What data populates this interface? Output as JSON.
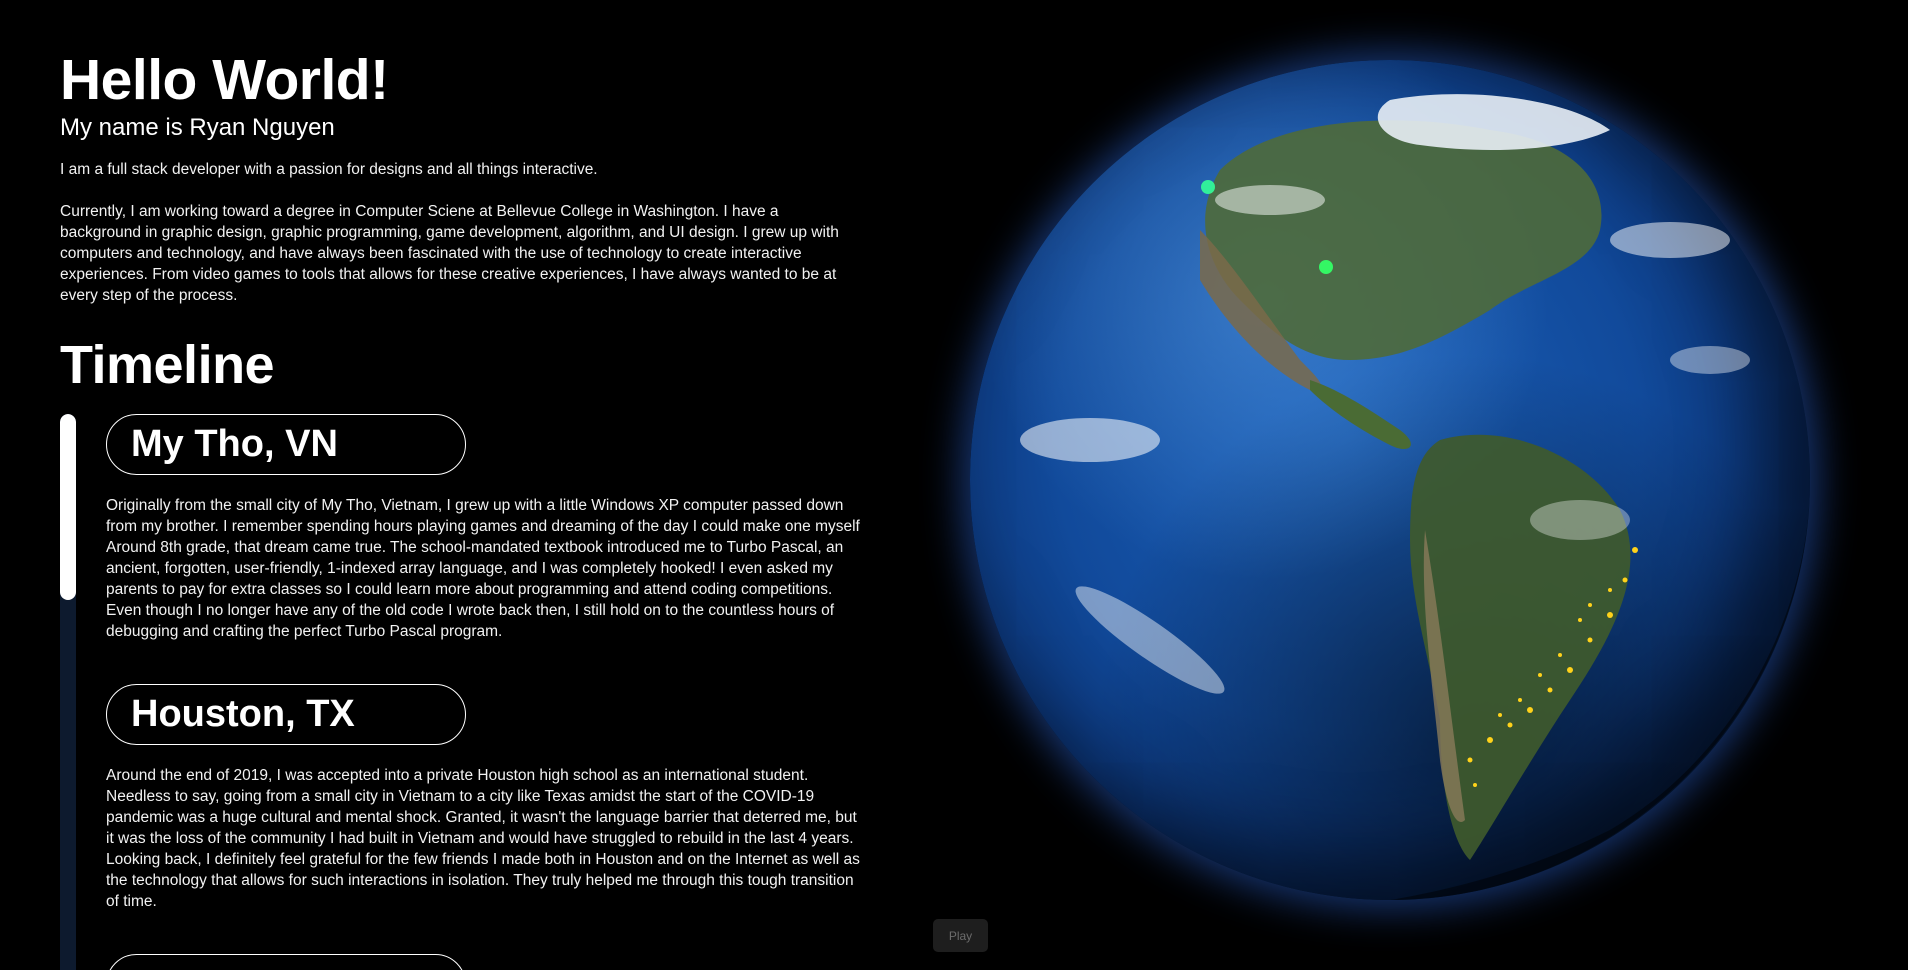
{
  "hero": {
    "title": "Hello World!",
    "subtitle": "My name is Ryan Nguyen",
    "intro": "I am a full stack developer with a passion for designs and all things interactive.",
    "bio": "Currently, I am working toward a degree in Computer Sciene at Bellevue College in Washington. I have a background in graphic design, graphic programming, game development, algorithm, and UI design. I grew up with computers and technology, and have always been fascinated with the use of technology to create interactive experiences. From video games to tools that allows for these creative experiences, I have always wanted to be at every step of the process."
  },
  "timeline": {
    "title": "Timeline",
    "progress": 0.32,
    "entries": [
      {
        "place": "My Tho, VN",
        "text": "Originally from the small city of My Tho, Vietnam, I grew up with a little Windows XP computer passed down from my brother. I remember spending hours playing games and dreaming of the day I could make one myself. Around 8th grade, that dream came true. The school-mandated textbook introduced me to Turbo Pascal, an ancient, forgotten, user-friendly, 1-indexed array language, and I was completely hooked! I even asked my parents to pay for extra classes so I could learn more about programming and attend coding competitions. Even though I no longer have any of the old code I wrote back then, I still hold on to the countless hours of debugging and crafting the perfect Turbo Pascal program."
      },
      {
        "place": "Houston, TX",
        "text": "Around the end of 2019, I was accepted into a private Houston high school as an international student. Needless to say, going from a small city in Vietnam to a city like Texas amidst the start of the COVID-19 pandemic was a huge cultural and mental shock. Granted, it wasn't the language barrier that deterred me, but it was the loss of the community I had built in Vietnam and would have struggled to rebuild in the last 4 years. Looking back, I definitely feel grateful for the few friends I made both in Houston and on the Internet as well as the technology that allows for such interactions in isolation. They truly helped me through this tough transition of time."
      },
      {
        "place": ""
      }
    ]
  },
  "controls": {
    "play_label": "Play"
  },
  "colors": {
    "background": "#000000",
    "ocean": "#114a9b",
    "marker": "#33ff66",
    "city_lights": "#ffd21a"
  }
}
